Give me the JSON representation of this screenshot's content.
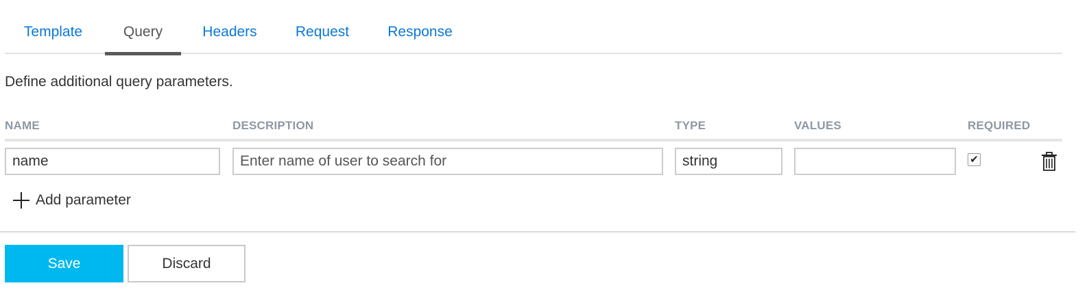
{
  "tabs": [
    {
      "label": "Template",
      "active": false
    },
    {
      "label": "Query",
      "active": true
    },
    {
      "label": "Headers",
      "active": false
    },
    {
      "label": "Request",
      "active": false
    },
    {
      "label": "Response",
      "active": false
    }
  ],
  "description": "Define additional query parameters.",
  "table": {
    "headers": {
      "name": "NAME",
      "description": "DESCRIPTION",
      "type": "TYPE",
      "values": "VALUES",
      "required": "REQUIRED"
    },
    "rows": [
      {
        "name": "name",
        "description": "",
        "description_placeholder": "Enter name of user to search for",
        "type": "string",
        "values": "",
        "required": true
      }
    ]
  },
  "add_parameter_label": "Add parameter",
  "buttons": {
    "save": "Save",
    "discard": "Discard"
  },
  "icons": {
    "delete": "trash-icon",
    "add": "plus-icon",
    "check": "checkmark-icon"
  },
  "colors": {
    "tab_link": "#0b78d7",
    "active_tab_underline": "#5a5a5a",
    "save_button": "#00b8f0",
    "header_text": "#8e98a4"
  }
}
